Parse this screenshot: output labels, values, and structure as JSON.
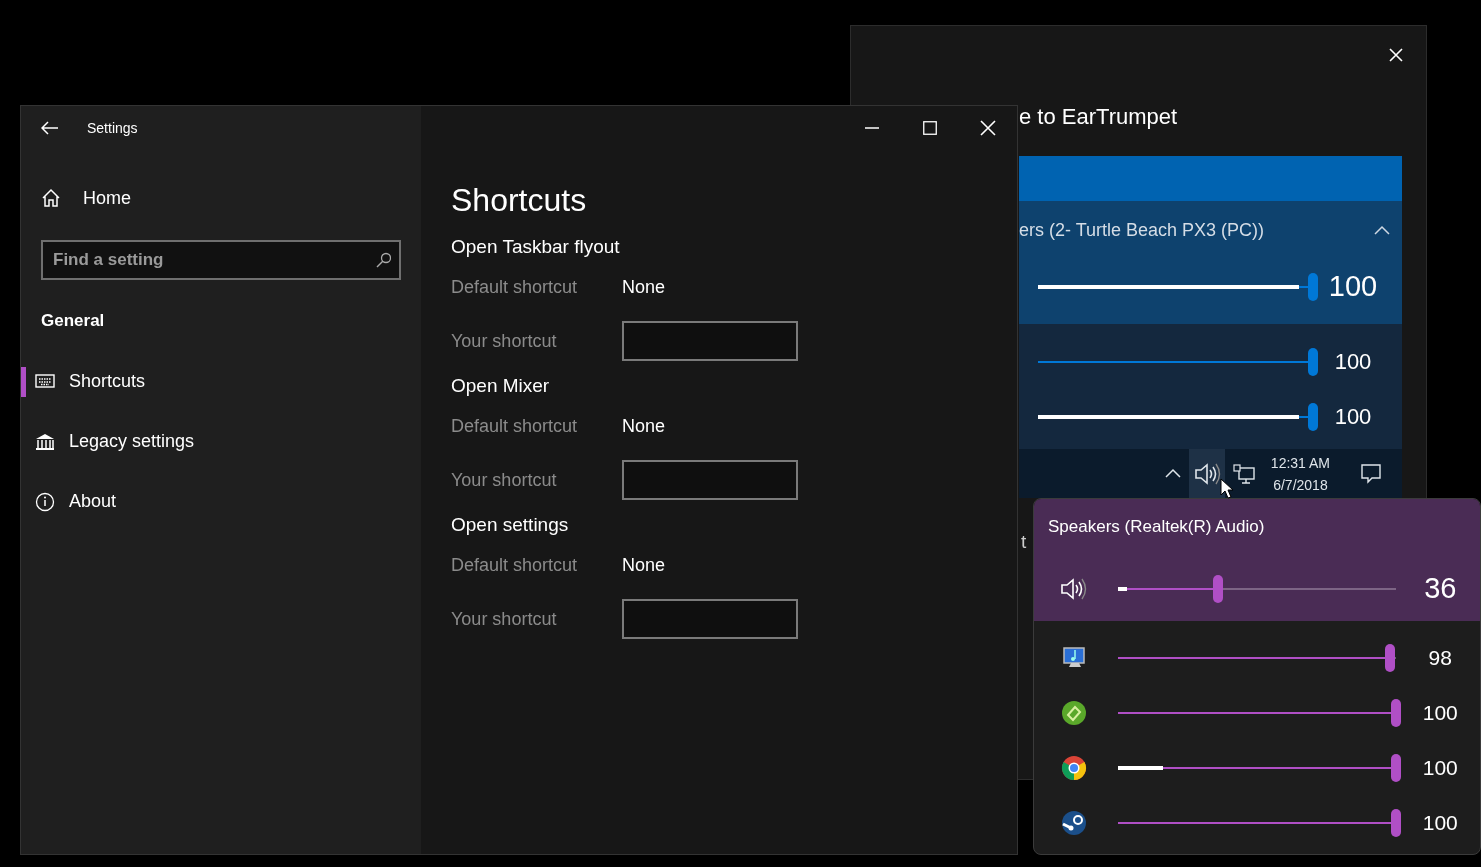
{
  "welcome_window": {
    "title": "e to EarTrumpet",
    "preview": {
      "device": "ers (2- Turtle Beach PX3 (PC))",
      "expanded": true,
      "sliders": [
        {
          "kind": "device",
          "level": 1,
          "value": "100",
          "meter": {
            "level": 0.95
          }
        },
        {
          "kind": "app",
          "level": 1,
          "value": "100"
        },
        {
          "kind": "app",
          "level": 1,
          "value": "100",
          "meter": {
            "level": 0.95
          }
        }
      ],
      "taskbar": {
        "time": "12:31 AM",
        "date": "6/7/2018"
      }
    },
    "cut_text": "t"
  },
  "settings_window": {
    "title": "Settings",
    "nav": {
      "home": "Home",
      "search": {
        "placeholder": "Find a setting"
      },
      "group": "General",
      "items": [
        {
          "label": "Shortcuts",
          "selected": true
        },
        {
          "label": "Legacy settings",
          "selected": false
        },
        {
          "label": "About",
          "selected": false
        }
      ]
    },
    "page": {
      "heading": "Shortcuts",
      "sections": [
        {
          "title": "Open Taskbar flyout",
          "default_label": "Default shortcut",
          "default_value": "None",
          "your_label": "Your shortcut"
        },
        {
          "title": "Open Mixer",
          "default_label": "Default shortcut",
          "default_value": "None",
          "your_label": "Your shortcut"
        },
        {
          "title": "Open settings",
          "default_label": "Default shortcut",
          "default_value": "None",
          "your_label": "Your shortcut"
        }
      ]
    }
  },
  "flyout": {
    "device": "Speakers (Realtek(R) Audio)",
    "master": {
      "level": 0.36,
      "value": "36",
      "meter": {
        "level": 0.03
      }
    },
    "apps": [
      {
        "level": 0.98,
        "value": "98"
      },
      {
        "level": 1,
        "value": "100"
      },
      {
        "level": 1,
        "value": "100",
        "meter": {
          "level": 0.16
        }
      },
      {
        "level": 1,
        "value": "100"
      }
    ]
  }
}
